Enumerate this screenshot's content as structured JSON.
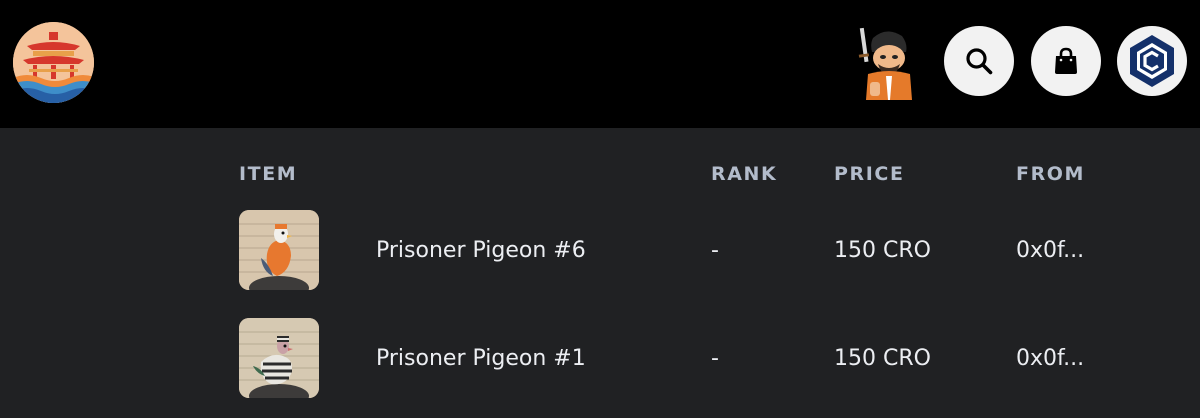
{
  "header": {
    "logo_icon": "pagoda-waves-logo",
    "avatar_icon": "samurai-cartoon-avatar",
    "buttons": [
      {
        "name": "search",
        "icon": "search-icon"
      },
      {
        "name": "cart",
        "icon": "shopping-bag-icon"
      },
      {
        "name": "wallet",
        "icon": "cronos-logo-icon"
      }
    ]
  },
  "table": {
    "columns": {
      "item": "ITEM",
      "rank": "RANK",
      "price": "PRICE",
      "from": "FROM"
    },
    "rows": [
      {
        "name": "Prisoner Pigeon #6",
        "rank": "-",
        "price": "150 CRO",
        "from": "0x0f..."
      },
      {
        "name": "Prisoner Pigeon #1",
        "rank": "-",
        "price": "150 CRO",
        "from": "0x0f..."
      }
    ]
  },
  "colors": {
    "topbar_bg": "#000000",
    "page_bg": "#202123",
    "header_text": "#b3bccb",
    "cell_text": "#eceef2",
    "cronos_blue": "#14306a"
  }
}
